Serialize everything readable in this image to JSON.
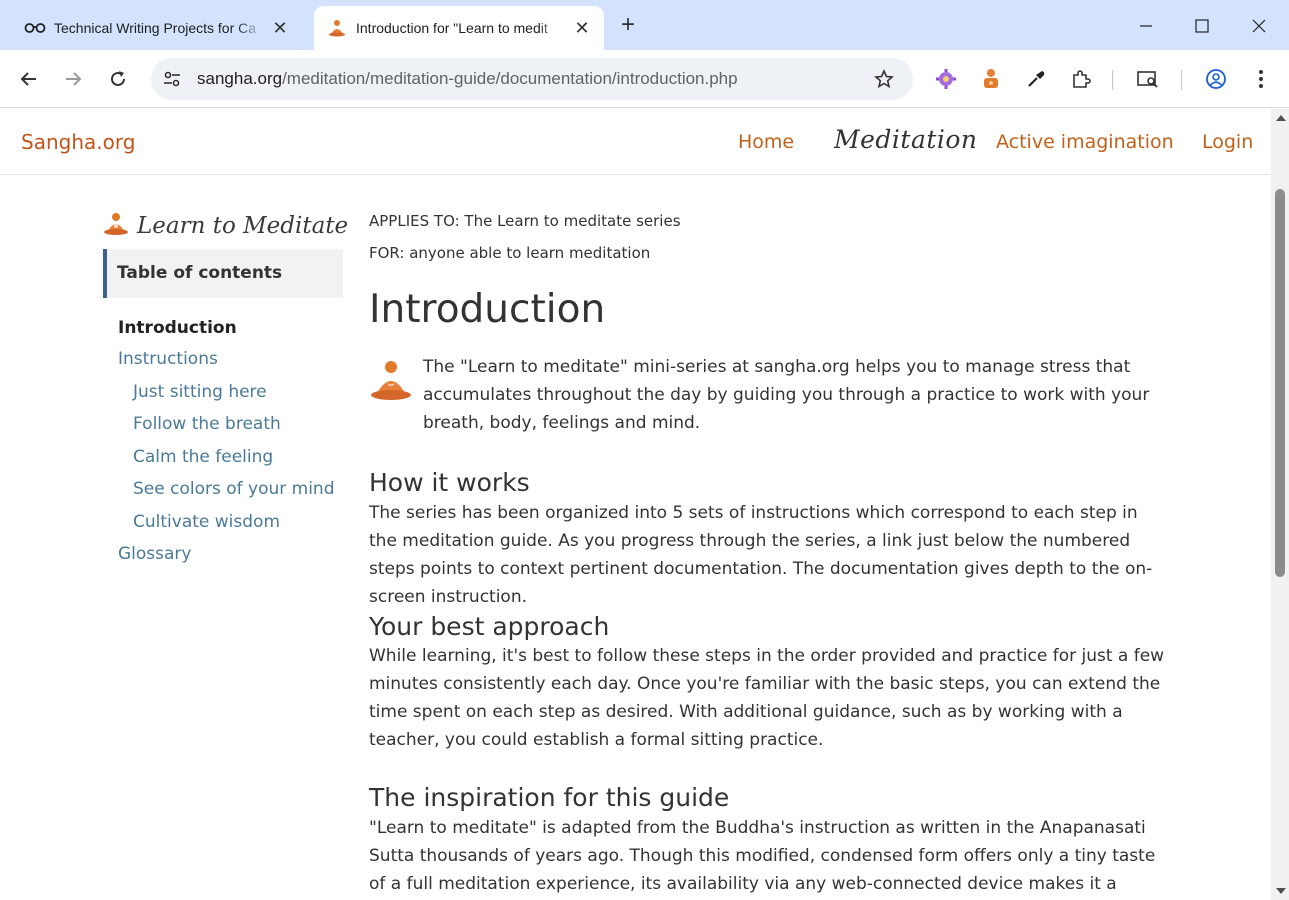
{
  "browser": {
    "tabs": [
      {
        "title": "Technical Writing Projects for Ca",
        "close": "✕"
      },
      {
        "title": "Introduction for \"Learn to medit",
        "close": "✕"
      }
    ],
    "new_tab": "+",
    "url_host": "sangha.org",
    "url_path": "/meditation/meditation-guide/documentation/introduction.php"
  },
  "header": {
    "brand": "Sangha.org",
    "nav": {
      "home": "Home",
      "meditation": "Meditation",
      "active_imagination": "Active imagination",
      "login": "Login"
    }
  },
  "sidebar": {
    "series_title": "Learn to Meditate",
    "toc_heading": "Table of contents",
    "items": [
      {
        "label": "Introduction"
      },
      {
        "label": "Instructions"
      },
      {
        "label": "Just sitting here"
      },
      {
        "label": "Follow the breath"
      },
      {
        "label": "Calm the feeling"
      },
      {
        "label": "See colors of your mind"
      },
      {
        "label": "Cultivate wisdom"
      },
      {
        "label": "Glossary"
      }
    ]
  },
  "content": {
    "applies_to": "APPLIES TO: The Learn to meditate series",
    "for": "FOR: anyone able to learn meditation",
    "title": "Introduction",
    "intro": "The \"Learn to meditate\" mini-series at sangha.org helps you to manage stress that accumulates throughout the day by guiding you through a practice to work with your breath, body, feelings and mind.",
    "sections": [
      {
        "heading": "How it works",
        "body": "The series has been organized into 5 sets of instructions which correspond to each step in the meditation guide. As you progress through the series, a link just below the numbered steps points to context pertinent documentation. The documentation gives depth to the on-screen instruction."
      },
      {
        "heading": "Your best approach",
        "body": "While learning, it's best to follow these steps in the order provided and practice for just a few minutes consistently each day. Once you're familiar with the basic steps, you can extend the time spent on each step as desired. With additional guidance, such as by working with a teacher, you could establish a formal sitting practice."
      },
      {
        "heading": "The inspiration for this guide",
        "body": "\"Learn to meditate\" is adapted from the Buddha's instruction as written in the Anapanasati Sutta thousands of years ago. Though this modified, condensed form offers only a tiny taste of a full meditation experience, its availability via any web-connected device makes it a perfect supplement for lunch or break"
      }
    ]
  },
  "colors": {
    "accent": "#c2621a",
    "link": "#4a7a99",
    "toc_bar": "#3b6190",
    "tabstrip": "#d3e3fd"
  }
}
